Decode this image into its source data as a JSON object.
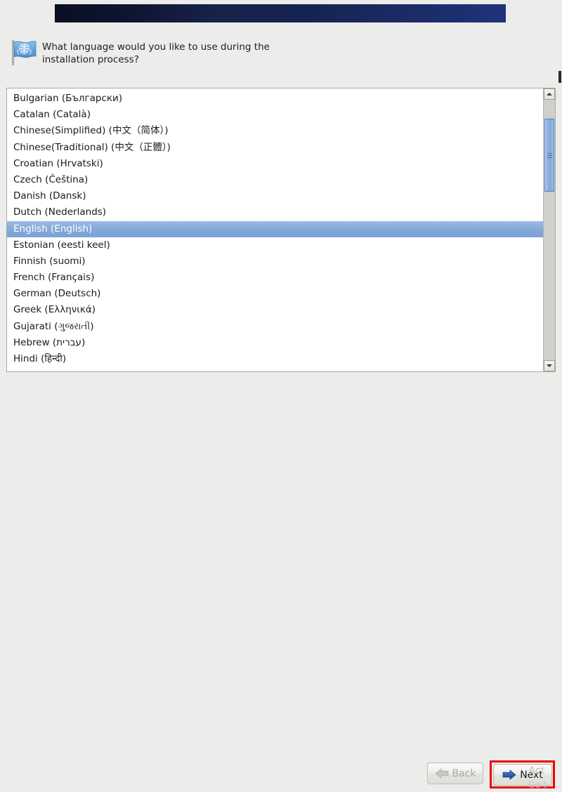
{
  "window": {
    "background_color": "#ececeb"
  },
  "banner": {
    "name": "installer-banner",
    "gradient_from": "#0a0f21",
    "gradient_to": "#21327a"
  },
  "question": {
    "icon": "un-flag-icon",
    "text": "What language would you like to use during the\ninstallation process?"
  },
  "language_list": {
    "selected": "English (English)",
    "items": [
      {
        "label": "Bulgarian (Български)",
        "selected": false
      },
      {
        "label": "Catalan (Català)",
        "selected": false
      },
      {
        "label": "Chinese(Simplified) (中文（简体）)",
        "selected": false
      },
      {
        "label": "Chinese(Traditional) (中文（正體）)",
        "selected": false
      },
      {
        "label": "Croatian (Hrvatski)",
        "selected": false
      },
      {
        "label": "Czech (Čeština)",
        "selected": false
      },
      {
        "label": "Danish (Dansk)",
        "selected": false
      },
      {
        "label": "Dutch (Nederlands)",
        "selected": false
      },
      {
        "label": "English (English)",
        "selected": true
      },
      {
        "label": "Estonian (eesti keel)",
        "selected": false
      },
      {
        "label": "Finnish (suomi)",
        "selected": false
      },
      {
        "label": "French (Français)",
        "selected": false
      },
      {
        "label": "German (Deutsch)",
        "selected": false
      },
      {
        "label": "Greek (Ελληνικά)",
        "selected": false
      },
      {
        "label": "Gujarati (ગુજરાતી)",
        "selected": false
      },
      {
        "label": "Hebrew (עברית)",
        "selected": false
      },
      {
        "label": "Hindi (हिन्दी)",
        "selected": false
      }
    ],
    "selection_color": "#84a8d8",
    "selection_text_color": "#ffffff"
  },
  "scrollbar": {
    "up_icon": "chevron-up-icon",
    "down_icon": "chevron-down-icon",
    "thumb_color": "#8fb3e0"
  },
  "footer": {
    "back": {
      "label": "Back",
      "icon": "arrow-left-icon",
      "disabled": true
    },
    "next": {
      "label": "Next",
      "icon": "arrow-right-icon",
      "disabled": false,
      "highlight_color": "#ee0000"
    }
  },
  "watermark": {
    "line1": "Act",
    "line2": "Go t"
  }
}
